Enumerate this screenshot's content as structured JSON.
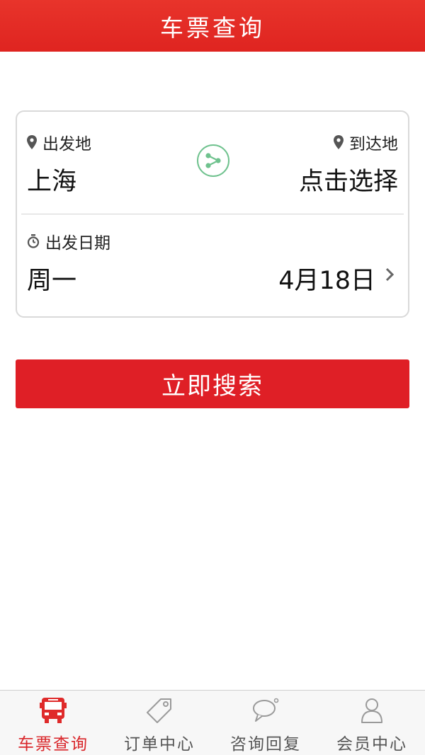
{
  "header": {
    "title": "车票查询"
  },
  "route": {
    "from_label": "出发地",
    "from_value": "上海",
    "to_label": "到达地",
    "to_value": "点击选择",
    "swap_icon": "share-swap-icon"
  },
  "date": {
    "label": "出发日期",
    "weekday": "周一",
    "value": "4月18日"
  },
  "search_button": {
    "label": "立即搜索"
  },
  "tabbar": {
    "tabs": [
      {
        "label": "车票查询",
        "icon": "bus-icon",
        "active": true
      },
      {
        "label": "订单中心",
        "icon": "tag-icon",
        "active": false
      },
      {
        "label": "咨询回复",
        "icon": "chat-bubble-icon",
        "active": false
      },
      {
        "label": "会员中心",
        "icon": "user-icon",
        "active": false
      }
    ]
  },
  "colors": {
    "brand_red": "#df1f26",
    "swap_green": "#6fc28e",
    "inactive_icon": "#9a9a9a"
  }
}
